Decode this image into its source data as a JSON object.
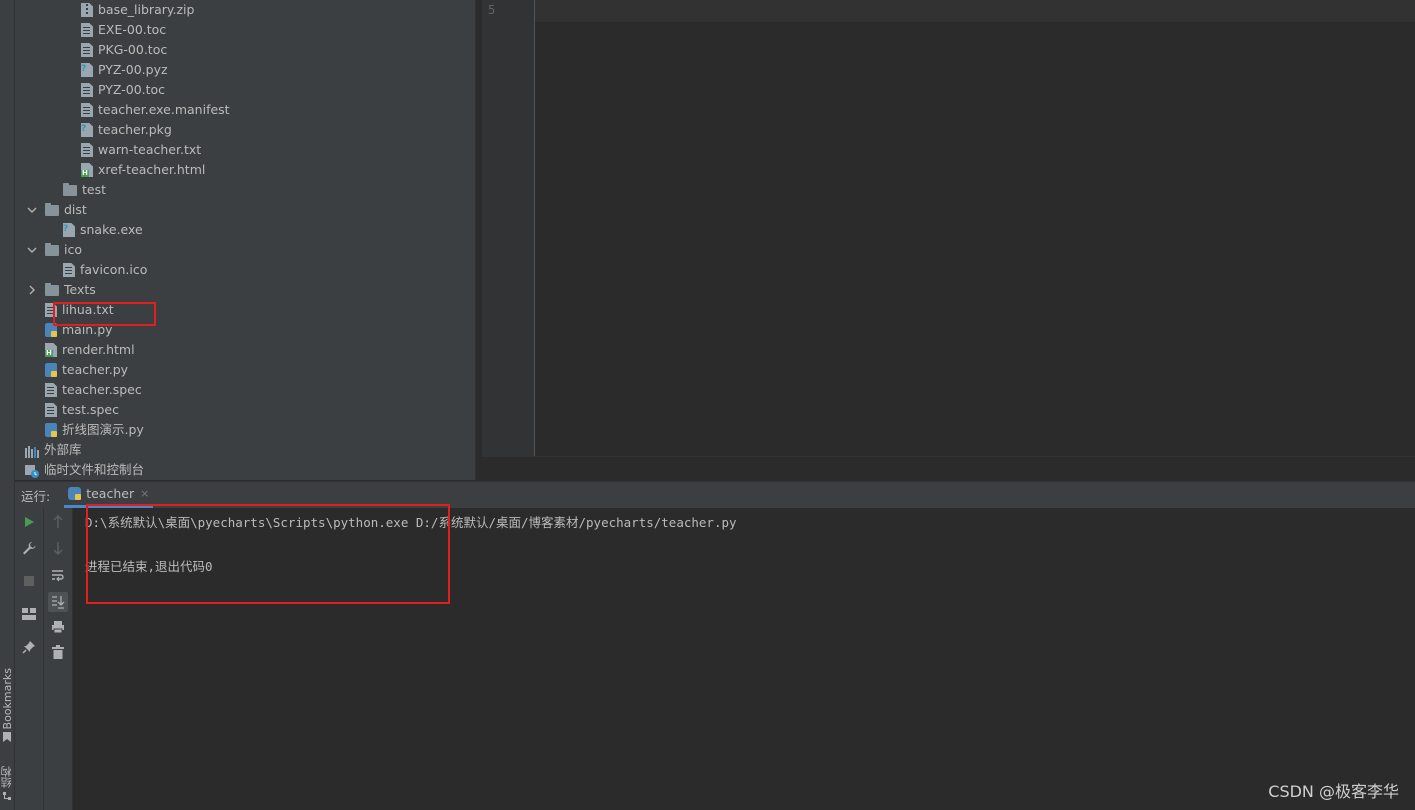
{
  "sidebar": {
    "bookmarks_label": "Bookmarks",
    "structure_label": "结构"
  },
  "tree": [
    {
      "name": "base_library.zip",
      "icon": "zip-icon",
      "depth": 3
    },
    {
      "name": "EXE-00.toc",
      "icon": "text-file-icon",
      "depth": 3
    },
    {
      "name": "PKG-00.toc",
      "icon": "text-file-icon",
      "depth": 3
    },
    {
      "name": "PYZ-00.pyz",
      "icon": "unknown-file-icon",
      "depth": 3
    },
    {
      "name": "PYZ-00.toc",
      "icon": "text-file-icon",
      "depth": 3
    },
    {
      "name": "teacher.exe.manifest",
      "icon": "text-file-icon",
      "depth": 3
    },
    {
      "name": "teacher.pkg",
      "icon": "unknown-file-icon",
      "depth": 3
    },
    {
      "name": "warn-teacher.txt",
      "icon": "text-file-icon",
      "depth": 3
    },
    {
      "name": "xref-teacher.html",
      "icon": "html-file-icon",
      "depth": 3
    },
    {
      "name": "test",
      "icon": "folder-icon",
      "depth": 2
    },
    {
      "name": "dist",
      "icon": "folder-icon",
      "depth": 1,
      "expanded": true
    },
    {
      "name": "snake.exe",
      "icon": "unknown-file-icon",
      "depth": 2
    },
    {
      "name": "ico",
      "icon": "folder-icon",
      "depth": 1,
      "expanded": true
    },
    {
      "name": "favicon.ico",
      "icon": "text-file-icon",
      "depth": 2
    },
    {
      "name": "Texts",
      "icon": "folder-icon",
      "depth": 1,
      "expanded": false
    },
    {
      "name": "lihua.txt",
      "icon": "text-file-icon",
      "depth": 1,
      "highlighted": true
    },
    {
      "name": "main.py",
      "icon": "python-file-icon",
      "depth": 1
    },
    {
      "name": "render.html",
      "icon": "html-file-icon",
      "depth": 1
    },
    {
      "name": "teacher.py",
      "icon": "python-file-icon",
      "depth": 1
    },
    {
      "name": "teacher.spec",
      "icon": "text-file-icon",
      "depth": 1
    },
    {
      "name": "test.spec",
      "icon": "text-file-icon",
      "depth": 1
    },
    {
      "name": "折线图演示.py",
      "icon": "python-file-icon",
      "depth": 1
    },
    {
      "name": "外部库",
      "icon": "library-icon",
      "depth": 0,
      "expanded": false
    },
    {
      "name": "临时文件和控制台",
      "icon": "scratch-icon",
      "depth": 0
    }
  ],
  "editor": {
    "line_number": "5"
  },
  "run": {
    "label": "运行:",
    "tab_label": "teacher",
    "close_glyph": "×",
    "console_lines": [
      "D:\\系统默认\\桌面\\pyecharts\\Scripts\\python.exe D:/系统默认/桌面/博客素材/pyecharts/teacher.py",
      "进程已结束,退出代码0"
    ]
  },
  "watermark": "CSDN @极客李华",
  "colors": {
    "highlight_border": "#e02020",
    "tab_underline": "#4a88c7",
    "run_green": "#499c54"
  }
}
